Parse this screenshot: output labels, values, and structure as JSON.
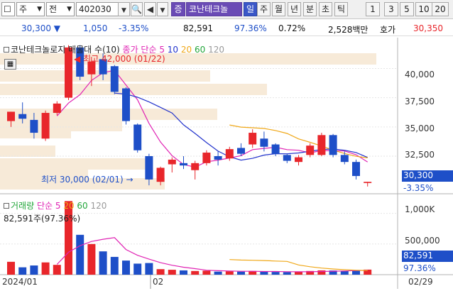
{
  "toolbar": {
    "market_code": "주",
    "type_label": "전",
    "ticker": "402030",
    "name_tag": "증",
    "stock_name": "코난테크놀",
    "periods": [
      "일",
      "주",
      "월",
      "년",
      "분",
      "초",
      "틱",
      "1",
      "3",
      "5",
      "10",
      "20"
    ],
    "active_period": "일"
  },
  "quote": {
    "price": "30,300 ▼",
    "change": "1,050",
    "change_pct": "-3.35%",
    "volume": "82,591",
    "volume_pct": "97.36%",
    "turnover_pct": "0.72%",
    "amount": "2,528백만",
    "ask_label": "호가",
    "ask_price": "30,350"
  },
  "price_panel": {
    "legend_name": "코난테크놀로지 매물대 수(10)",
    "legend_ma": "종가 단순 5",
    "ma_periods": [
      "10",
      "20",
      "60",
      "120"
    ],
    "high_label": "최고 42,000 (01/22)",
    "low_label": "최저 30,000 (02/01)",
    "axis_ticks": [
      "40,000",
      "37,500",
      "35,000",
      "32,500"
    ],
    "current_price": "30,300",
    "current_pct": "-3.35%"
  },
  "volume_panel": {
    "legend_name": "거래량",
    "legend_ma": "단순 5",
    "ma_periods": [
      "20",
      "60",
      "120"
    ],
    "value_label": "82,591주(97.36%)",
    "axis_ticks": [
      "1,000K",
      "500,000"
    ],
    "current_volume": "82,591",
    "current_pct": "97.36%"
  },
  "x_labels": [
    "2024/01",
    "02",
    "02/29"
  ],
  "colors": {
    "up": "#e8262b",
    "down": "#1e4fc8",
    "ma5": "#e024b4",
    "ma10": "#2233cc",
    "ma20": "#f0a818",
    "ma60": "#22a63a",
    "ma120": "#999999",
    "active": "#3a57c8"
  },
  "chart_data": {
    "type": "candlestick",
    "title": "코난테크놀로지",
    "y_ticks": [
      32500,
      35000,
      37500,
      40000
    ],
    "candles": [
      {
        "open": 35500,
        "high": 36300,
        "low": 35000,
        "close": 36300
      },
      {
        "open": 36100,
        "high": 37100,
        "low": 35300,
        "close": 35700
      },
      {
        "open": 35600,
        "high": 36200,
        "low": 34000,
        "close": 34500
      },
      {
        "open": 34000,
        "high": 36400,
        "low": 33800,
        "close": 36200
      },
      {
        "open": 36200,
        "high": 37200,
        "low": 36000,
        "close": 37000
      },
      {
        "open": 37500,
        "high": 42000,
        "low": 37300,
        "close": 41800
      },
      {
        "open": 41800,
        "high": 42000,
        "low": 39000,
        "close": 39300
      },
      {
        "open": 39500,
        "high": 41000,
        "low": 38500,
        "close": 40600
      },
      {
        "open": 40800,
        "high": 41300,
        "low": 39000,
        "close": 39500
      },
      {
        "open": 40200,
        "high": 40300,
        "low": 37800,
        "close": 38000
      },
      {
        "open": 38300,
        "high": 38400,
        "low": 35200,
        "close": 35500
      },
      {
        "open": 35200,
        "high": 35300,
        "low": 32800,
        "close": 33000
      },
      {
        "open": 32500,
        "high": 32700,
        "low": 30000,
        "close": 30500
      },
      {
        "open": 30300,
        "high": 31600,
        "low": 30000,
        "close": 31500
      },
      {
        "open": 31800,
        "high": 32400,
        "low": 31100,
        "close": 32200
      },
      {
        "open": 31900,
        "high": 32500,
        "low": 31400,
        "close": 31700
      },
      {
        "open": 31300,
        "high": 32100,
        "low": 30500,
        "close": 31900
      },
      {
        "open": 31900,
        "high": 33000,
        "low": 31700,
        "close": 32800
      },
      {
        "open": 32500,
        "high": 32900,
        "low": 31700,
        "close": 32200
      },
      {
        "open": 32300,
        "high": 33300,
        "low": 32100,
        "close": 33100
      },
      {
        "open": 33200,
        "high": 33600,
        "low": 32500,
        "close": 32700
      },
      {
        "open": 33500,
        "high": 34800,
        "low": 33200,
        "close": 34500
      },
      {
        "open": 34000,
        "high": 34600,
        "low": 32900,
        "close": 33300
      },
      {
        "open": 33500,
        "high": 33600,
        "low": 32500,
        "close": 32700
      },
      {
        "open": 32600,
        "high": 32700,
        "low": 31900,
        "close": 32100
      },
      {
        "open": 32000,
        "high": 32600,
        "low": 31700,
        "close": 32400
      },
      {
        "open": 32600,
        "high": 33600,
        "low": 32400,
        "close": 33400
      },
      {
        "open": 32600,
        "high": 34500,
        "low": 32500,
        "close": 34300
      },
      {
        "open": 34300,
        "high": 34400,
        "low": 32400,
        "close": 32600
      },
      {
        "open": 32600,
        "high": 32900,
        "low": 31800,
        "close": 32000
      },
      {
        "open": 32000,
        "high": 32200,
        "low": 30500,
        "close": 30800
      },
      {
        "open": 30200,
        "high": 30300,
        "low": 29900,
        "close": 30300
      }
    ],
    "volumes": [
      210000,
      120000,
      150000,
      200000,
      160000,
      1200000,
      650000,
      500000,
      380000,
      290000,
      230000,
      180000,
      190000,
      90000,
      80000,
      70000,
      60000,
      65000,
      50000,
      55000,
      50000,
      60000,
      48000,
      45000,
      42000,
      45000,
      60000,
      70000,
      68000,
      60000,
      75000,
      82591
    ]
  }
}
